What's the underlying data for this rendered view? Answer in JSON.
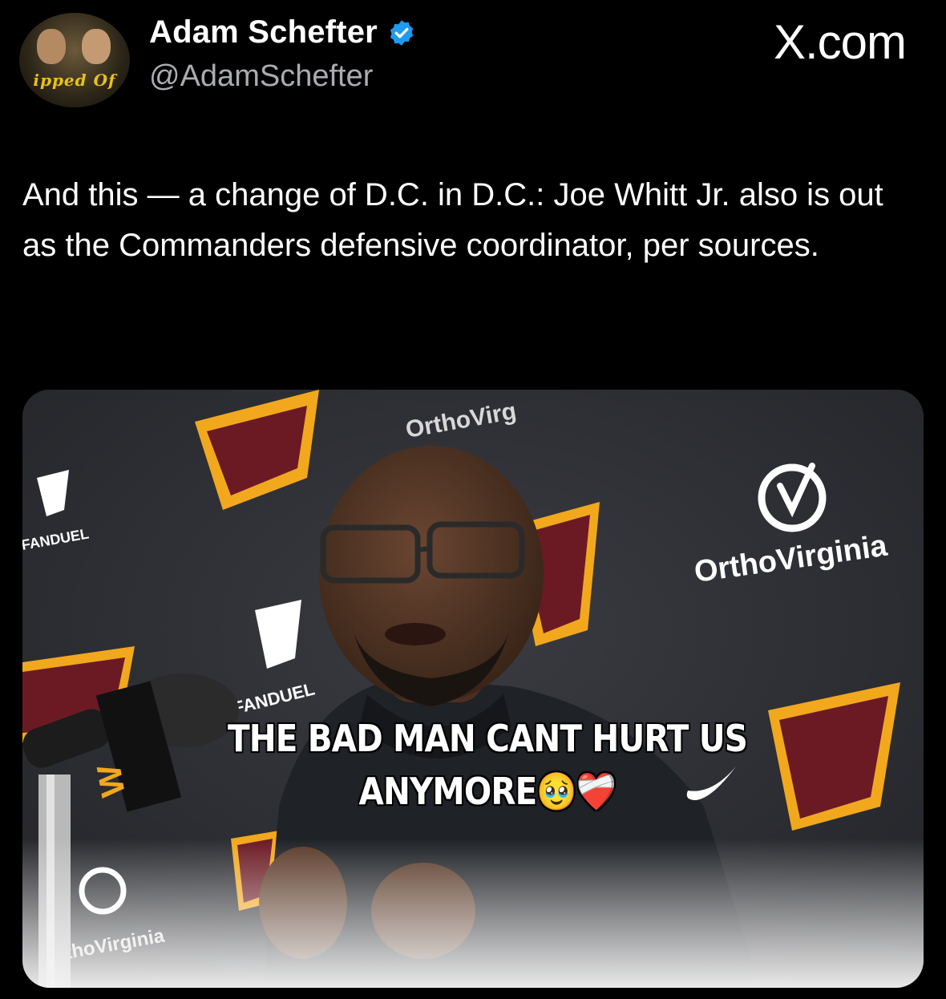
{
  "tweet": {
    "author_name": "Adam Schefter",
    "author_handle": "@AdamSchefter",
    "verified": true,
    "avatar_banner_text": "ipped Of",
    "source": "X.com",
    "text": "And this — a change of D.C. in D.C.: Joe Whitt Jr. also is out as the Commanders defensive coordinator, per sources."
  },
  "media": {
    "caption": "THE BAD MAN CANT HURT US ANYMORE🥹❤️‍🩹",
    "backdrop_text": {
      "sponsor_top": "OrthoVirg",
      "sponsor_right": "OrthoVirginia",
      "sponsor_left_small": "FANDUEL",
      "sponsor_mid_small": "FANDUEL",
      "sponsor_bottom": "thoVirginia",
      "team_logo_letter": "W"
    },
    "colors": {
      "burgundy": "#6b1a24",
      "gold": "#f2a81d",
      "backdrop": "#2d2e33"
    }
  }
}
